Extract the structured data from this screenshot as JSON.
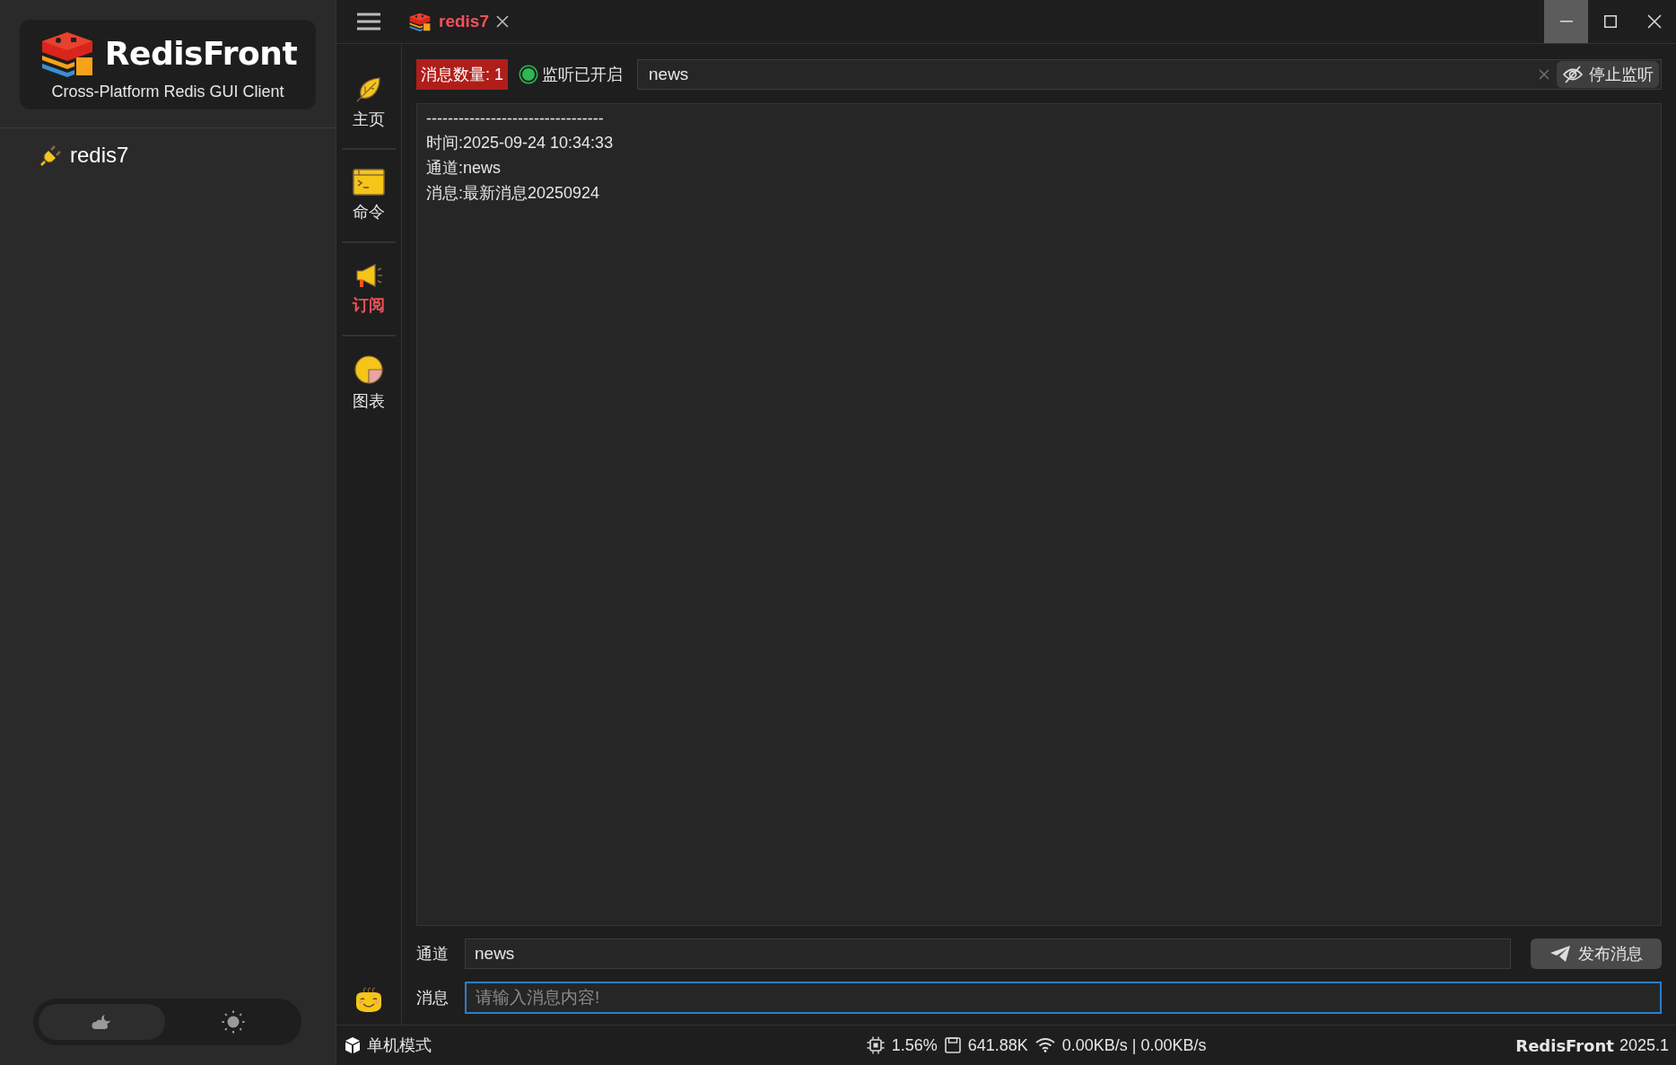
{
  "sidebar": {
    "logo": {
      "title": "RedisFront",
      "subtitle": "Cross-Platform Redis GUI Client"
    },
    "connections": [
      {
        "name": "redis7"
      }
    ],
    "theme_options": [
      {
        "kind": "dark",
        "selected": true
      },
      {
        "kind": "light",
        "selected": false
      }
    ]
  },
  "tabs": [
    {
      "label": "redis7",
      "selected": true
    }
  ],
  "nav": [
    {
      "label": "主页",
      "kind": "home",
      "selected": false
    },
    {
      "label": "命令",
      "kind": "command",
      "selected": false
    },
    {
      "label": "订阅",
      "kind": "subscribe",
      "selected": true
    },
    {
      "label": "图表",
      "kind": "chart",
      "selected": false
    }
  ],
  "subscribe": {
    "message_count": "消息数量: 1",
    "listening": {
      "label": "监听已开启",
      "on": true
    },
    "channel_filter": {
      "value": "news"
    },
    "stop_button": "停止监听",
    "log": [
      "---------------------------------",
      "时间:2025-09-24 10:34:33",
      "通道:news",
      "消息:最新消息20250924"
    ],
    "publish": {
      "channel_label": "通道",
      "channel_value": "news",
      "publish_button": "发布消息",
      "message_label": "消息",
      "message_placeholder": "请输入消息内容!"
    }
  },
  "status_bar": {
    "mode": "单机模式",
    "cpu": "1.56%",
    "memory": "641.88K",
    "network": "0.00KB/s | 0.00KB/s",
    "brand": "RedisFront",
    "version": "2025.1"
  }
}
